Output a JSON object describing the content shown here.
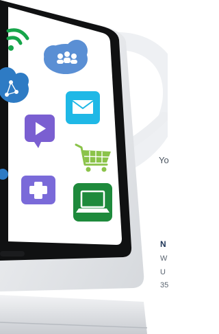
{
  "page": {
    "tagline": "Yo",
    "address": {
      "title": "N",
      "line1": "W",
      "line2": "U",
      "line3": "35"
    }
  },
  "icons": {
    "wifi": "wifi-icon",
    "people_cloud": "people-cloud-icon",
    "network_cloud": "network-cloud-icon",
    "mail": "mail-icon",
    "play": "play-icon",
    "cart": "shopping-cart-icon",
    "plus": "plus-icon",
    "laptop": "laptop-icon"
  },
  "colors": {
    "wifi": "#16a54a",
    "cloud": "#5a8fd4",
    "network_cloud": "#2e7bc4",
    "mail": "#1fb8e6",
    "play": "#7a5fd1",
    "cart": "#8bc34a",
    "plus": "#7a6ad9",
    "laptop": "#1e8a3c",
    "bezel": "#111111",
    "body": "#e5e7ea"
  }
}
